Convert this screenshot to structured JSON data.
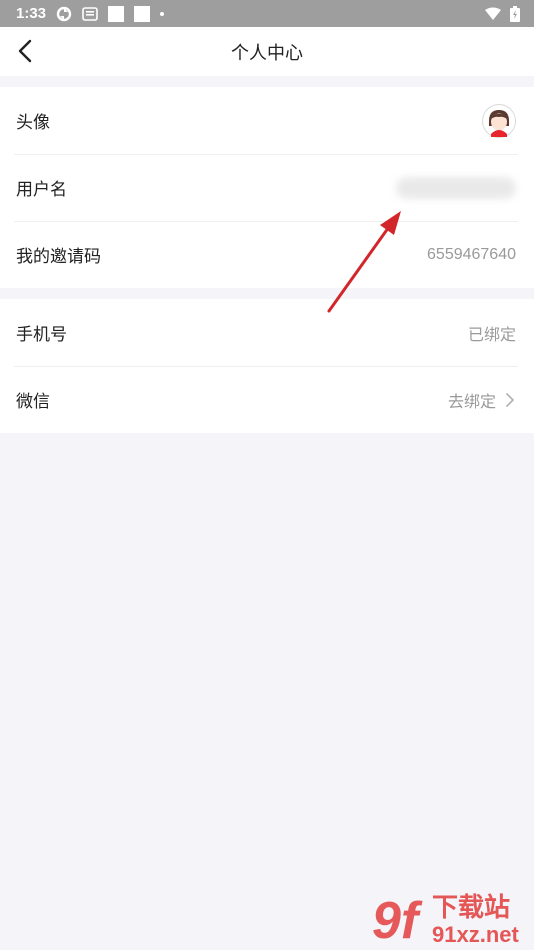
{
  "status_bar": {
    "time": "1:33"
  },
  "header": {
    "title": "个人中心"
  },
  "profile": {
    "avatar_label": "头像",
    "username_label": "用户名",
    "invite_label": "我的邀请码",
    "invite_code": "6559467640"
  },
  "bindings": {
    "phone_label": "手机号",
    "phone_status": "已绑定",
    "wechat_label": "微信",
    "wechat_action": "去绑定"
  },
  "watermark": {
    "brand": "下载站",
    "domain": "91xz.net",
    "logo_mark": "9f"
  },
  "colors": {
    "annotation_arrow": "#d3262a",
    "watermark": "#e34848",
    "background": "#f4f4f9"
  }
}
